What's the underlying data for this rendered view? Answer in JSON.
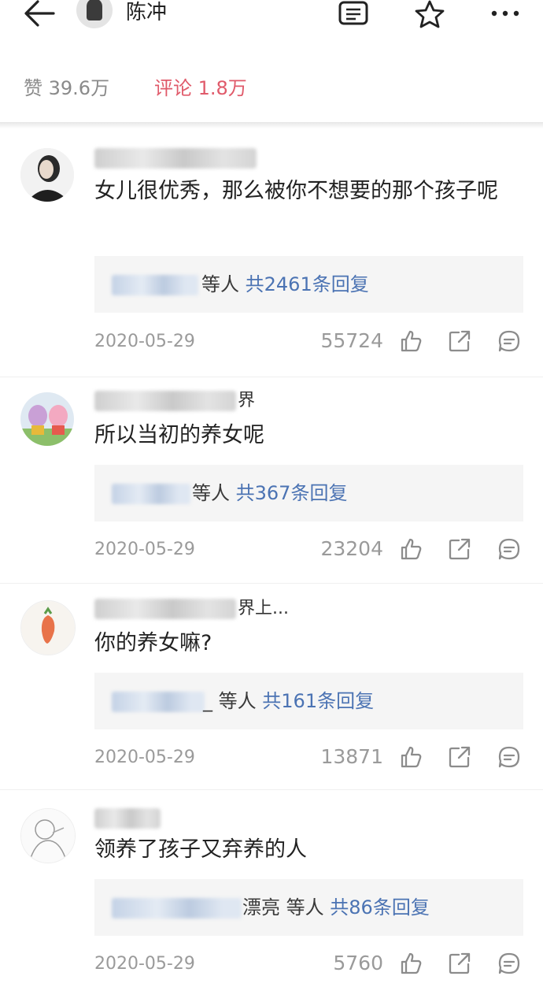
{
  "header": {
    "author_name": "陈冲",
    "back_icon": "arrow-left-icon",
    "list_icon": "document-list-icon",
    "favorite_icon": "star-icon",
    "more_icon": "more-dots-icon"
  },
  "stats": {
    "likes_label": "赞 39.6万",
    "comments_label": "评论 1.8万",
    "comments_color": "#e05a6a"
  },
  "comments": [
    {
      "name_visible_suffix": "",
      "text": "女儿很优秀，那么被你不想要的那个孩子呢",
      "reply_who": "等人",
      "reply_count": "共2461条回复",
      "date": "2020-05-29",
      "likes": "55724"
    },
    {
      "name_visible_suffix": "界",
      "text": "所以当初的养女呢",
      "reply_who": "等人",
      "reply_count": "共367条回复",
      "date": "2020-05-29",
      "likes": "23204"
    },
    {
      "name_visible_suffix": "界上...",
      "text": "你的养女嘛?",
      "reply_who": "_ 等人",
      "reply_count": "共161条回复",
      "date": "2020-05-29",
      "likes": "13871"
    },
    {
      "name_visible_suffix": "",
      "text": "领养了孩子又弃养的人",
      "reply_who": "漂亮 等人",
      "reply_count": "共86条回复",
      "date": "2020-05-29",
      "likes": "5760"
    }
  ],
  "icons": {
    "like": "thumbs-up-icon",
    "share": "share-icon",
    "comment": "comment-bubble-icon"
  },
  "colors": {
    "link_blue": "#4b73b3",
    "meta_gray": "#9a9a9a"
  }
}
